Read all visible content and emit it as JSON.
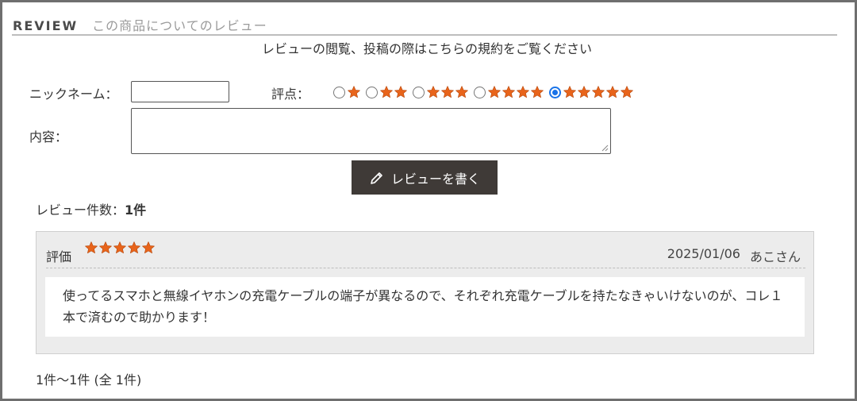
{
  "header": {
    "title": "REVIEW",
    "subtitle": "この商品についてのレビュー"
  },
  "policy": {
    "link_text": "レビューの閲覧、投稿の際はこちらの規約をご覧ください"
  },
  "form": {
    "nickname_label": "ニックネーム：",
    "nickname_value": "",
    "score_label": "評点：",
    "rating_options": [
      1,
      2,
      3,
      4,
      5
    ],
    "selected_rating": 5,
    "content_label": "内容：",
    "content_value": "",
    "submit_label": "レビューを書く"
  },
  "colors": {
    "star": "#e8641b",
    "button_bg": "#3f3a37",
    "radio_checked": "#1a73e8"
  },
  "summary": {
    "count_label": "レビュー件数：",
    "count_value": "1件"
  },
  "review": {
    "eval_label": "評価",
    "stars": 5,
    "date": "2025/01/06",
    "author": "あこさん",
    "body": "使ってるスマホと無線イヤホンの充電ケーブルの端子が異なるので、それぞれ充電ケーブルを持たなきゃいけないのが、コレ１本で済むので助かります！"
  },
  "pagination": {
    "text": "1件～1件 (全 1件)"
  },
  "icons": {
    "star": "star-icon",
    "pencil": "pencil-icon"
  }
}
